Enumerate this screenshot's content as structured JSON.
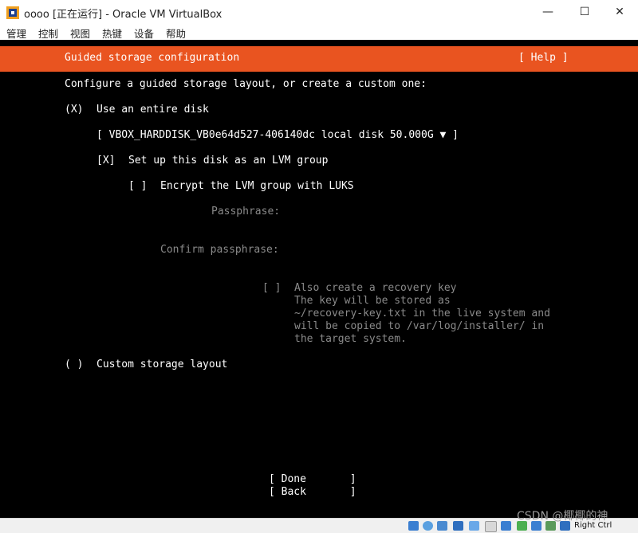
{
  "window": {
    "title": "oooo [正在运行] - Oracle VM VirtualBox",
    "buttons": {
      "minimize": "—",
      "maximize": "☐",
      "close": "✕"
    }
  },
  "menu": [
    "管理",
    "控制",
    "视图",
    "热键",
    "设备",
    "帮助"
  ],
  "installer": {
    "header_title": "Guided storage configuration",
    "help_button": "[ Help ]",
    "intro": "Configure a guided storage layout, or create a custom one:",
    "entire_disk_radio": "(X)",
    "entire_disk_label": "Use an entire disk",
    "disk_select": "[ VBOX_HARDDISK_VB0e64d527-406140dc local disk 50.000G ▼ ]",
    "lvm_checkbox": "[X]",
    "lvm_label": "Set up this disk as an LVM group",
    "luks_checkbox": "[ ]",
    "luks_label": "Encrypt the LVM group with LUKS",
    "passphrase_label": "Passphrase:",
    "confirm_label": "Confirm passphrase:",
    "recovery_checkbox": "[ ]",
    "recovery_lines": [
      "Also create a recovery key",
      "The key will be stored as",
      "~/recovery-key.txt in the live system and",
      "will be copied to /var/log/installer/ in",
      "the target system."
    ],
    "custom_radio": "( )",
    "custom_label": "Custom storage layout",
    "done_button": "[ Done       ]",
    "back_button": "[ Back       ]"
  },
  "statusbar": {
    "icons": [
      "hdd-icon",
      "optical-icon",
      "audio-icon",
      "network-icon",
      "usb-icon",
      "shared-folder-icon",
      "display-icon",
      "recording-icon",
      "capture-icon",
      "mouse-integration-icon",
      "keyboard-icon"
    ],
    "host_key": "Right Ctrl"
  },
  "watermark": "CSDN @椰椰的神"
}
